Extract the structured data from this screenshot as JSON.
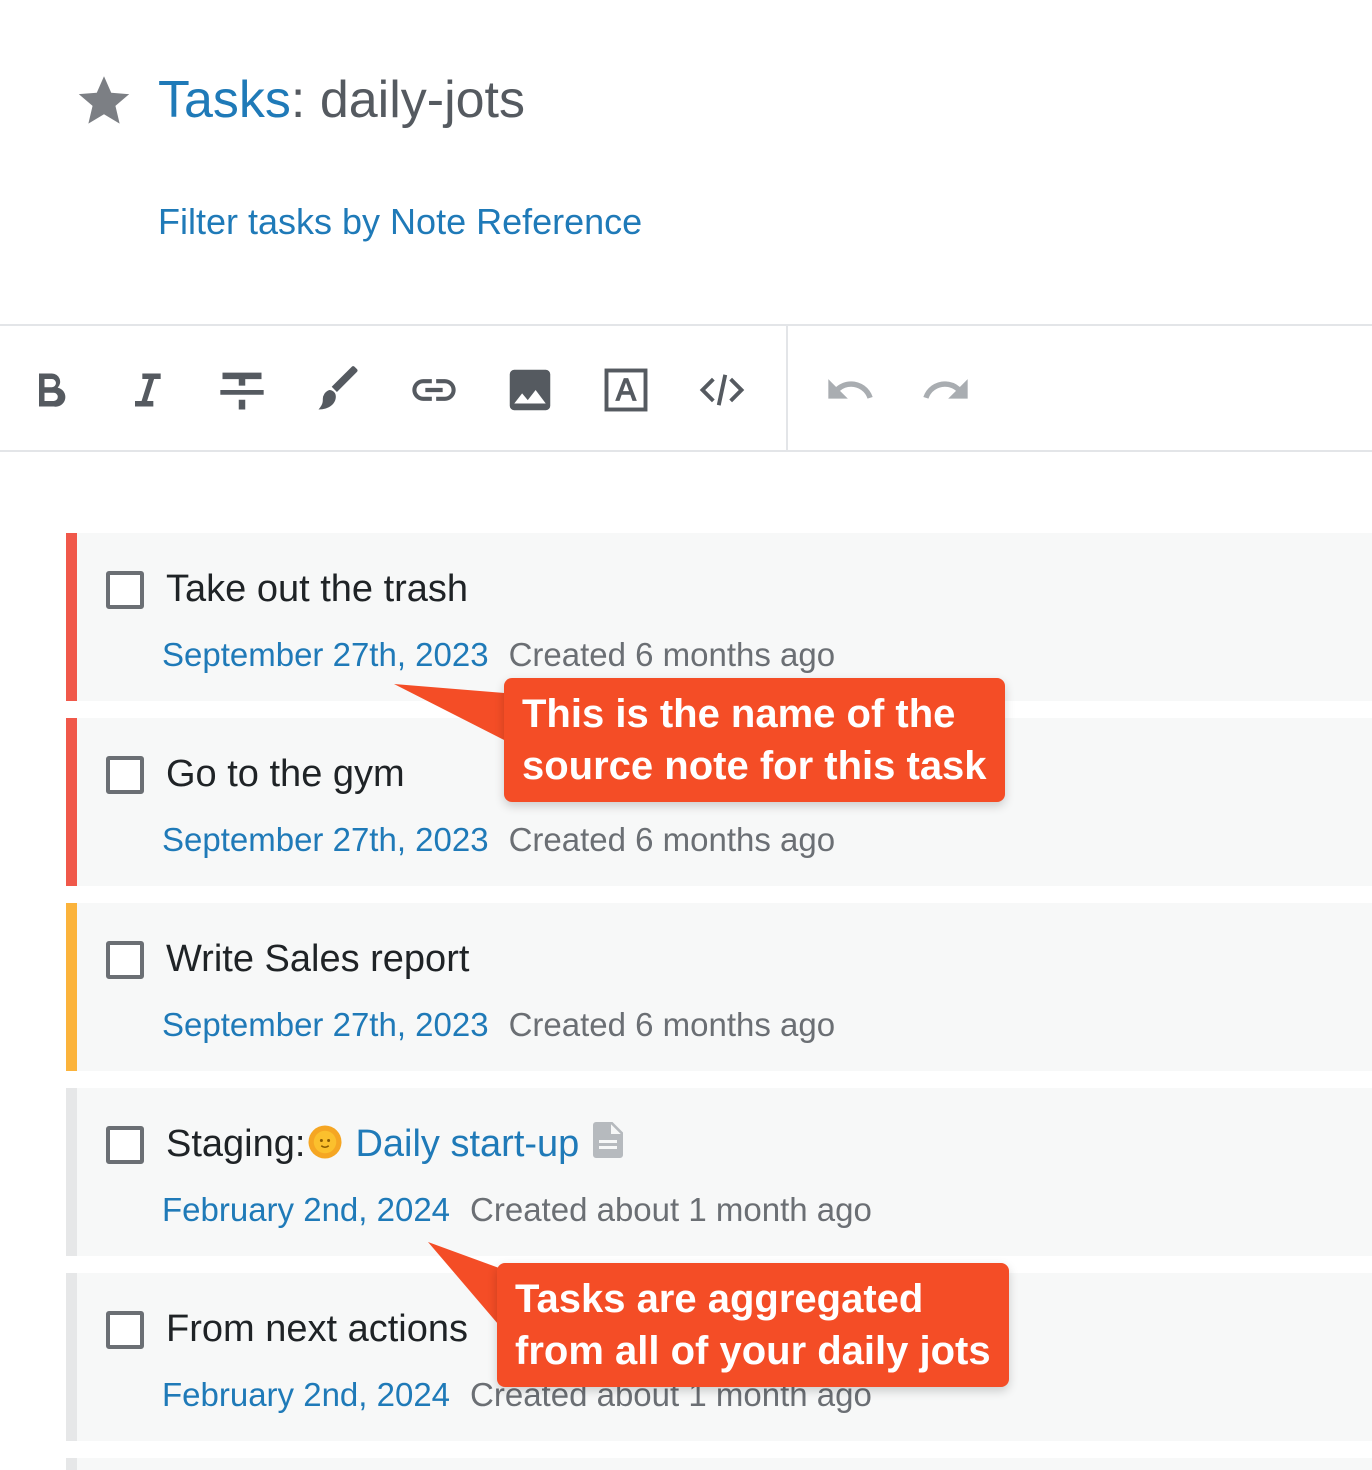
{
  "header": {
    "title_prefix": "Tasks",
    "title_separator": ":",
    "title_name": " daily-jots",
    "filter_link": "Filter tasks by Note Reference"
  },
  "toolbar": {
    "buttons": [
      "bold-icon",
      "italic-icon",
      "strikethrough-icon",
      "brush-icon",
      "link-icon",
      "image-icon",
      "text-box-icon",
      "code-icon",
      "undo-icon",
      "redo-icon"
    ]
  },
  "tasks": [
    {
      "text": "Take out the trash",
      "date": "September 27th, 2023",
      "created": "Created 6 months ago",
      "accent": "#f0584a"
    },
    {
      "text": "Go to the gym",
      "date": "September 27th, 2023",
      "created": "Created 6 months ago",
      "accent": "#f0584a"
    },
    {
      "text": "Write Sales report",
      "date": "September 27th, 2023",
      "created": "Created 6 months ago",
      "accent": "#fbb33b"
    },
    {
      "text": "Staging:",
      "link": "Daily start-up",
      "date": "February 2nd, 2024",
      "created": "Created about 1 month ago",
      "accent": "#e6e7e8"
    },
    {
      "text": "From next actions",
      "date": "February 2nd, 2024",
      "created": "Created about 1 month ago",
      "accent": "#e6e7e8"
    }
  ],
  "callouts": [
    {
      "line1": "This is the name of the",
      "line2": "source note for this task"
    },
    {
      "line1": "Tasks are aggregated",
      "line2": "from all of your daily jots"
    }
  ],
  "colors": {
    "link": "#1f7ab8",
    "callout": "#f44d26",
    "accent_red": "#f0584a",
    "accent_yellow": "#fbb33b"
  }
}
